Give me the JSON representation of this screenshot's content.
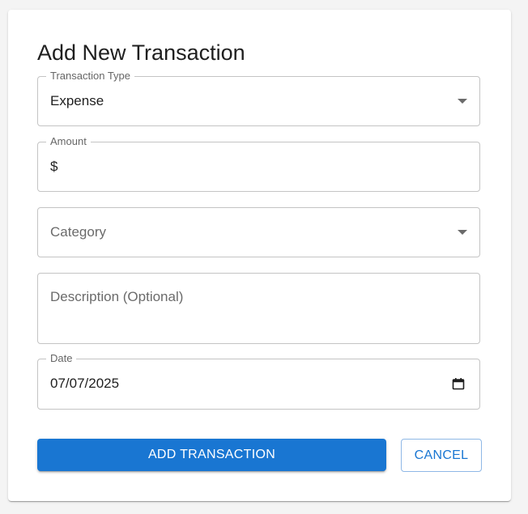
{
  "form": {
    "title": "Add New Transaction",
    "transaction_type": {
      "label": "Transaction Type",
      "value": "Expense"
    },
    "amount": {
      "label": "Amount",
      "prefix": "$",
      "value": ""
    },
    "category": {
      "placeholder": "Category"
    },
    "description": {
      "placeholder": "Description (Optional)"
    },
    "date": {
      "label": "Date",
      "value": "07/07/2025"
    },
    "actions": {
      "submit_label": "ADD TRANSACTION",
      "cancel_label": "CANCEL"
    }
  },
  "colors": {
    "primary": "#1976d2",
    "border": "#c4c4c4",
    "background": "#f4f4f4"
  }
}
